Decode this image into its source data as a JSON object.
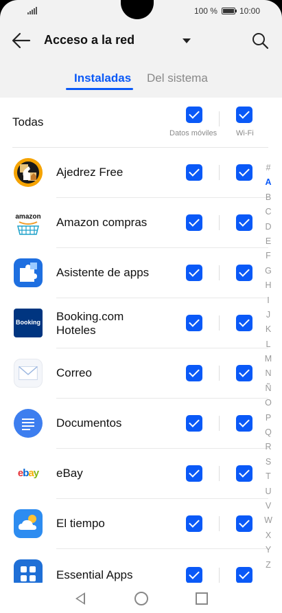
{
  "status": {
    "battery": "100 %",
    "time": "10:00"
  },
  "header": {
    "title": "Acceso a la red"
  },
  "tabs": [
    {
      "label": "Instaladas",
      "active": true
    },
    {
      "label": "Del sistema",
      "active": false
    }
  ],
  "all_row": {
    "label": "Todas",
    "mobile_data_label": "Datos móviles",
    "wifi_label": "Wi-Fi",
    "mobile_checked": true,
    "wifi_checked": true
  },
  "apps": [
    {
      "name": "Ajedrez Free",
      "icon": "chess-app-icon",
      "mobile": true,
      "wifi": true
    },
    {
      "name": "Amazon compras",
      "icon": "amazon-app-icon",
      "icon_text": "amazon",
      "mobile": true,
      "wifi": true
    },
    {
      "name": "Asistente de apps",
      "icon": "puzzle-app-icon",
      "mobile": true,
      "wifi": true
    },
    {
      "name": "Booking.com Hoteles",
      "name_line1": "Booking.com",
      "name_line2": "Hoteles",
      "icon": "booking-app-icon",
      "icon_text": "Booking",
      "mobile": true,
      "wifi": true
    },
    {
      "name": "Correo",
      "icon": "mail-app-icon",
      "mobile": true,
      "wifi": true
    },
    {
      "name": "Documentos",
      "icon": "documents-app-icon",
      "mobile": true,
      "wifi": true
    },
    {
      "name": "eBay",
      "icon": "ebay-app-icon",
      "icon_text": "ebay",
      "mobile": true,
      "wifi": true
    },
    {
      "name": "El tiempo",
      "icon": "weather-app-icon",
      "mobile": true,
      "wifi": true
    },
    {
      "name": "Essential Apps",
      "icon": "essential-apps-icon",
      "mobile": true,
      "wifi": true
    }
  ],
  "index": [
    "#",
    "A",
    "B",
    "C",
    "D",
    "E",
    "F",
    "G",
    "H",
    "I",
    "J",
    "K",
    "L",
    "M",
    "N",
    "Ñ",
    "O",
    "P",
    "Q",
    "R",
    "S",
    "T",
    "U",
    "V",
    "W",
    "X",
    "Y",
    "Z"
  ],
  "index_selected": "A",
  "colors": {
    "accent": "#0a59f7"
  }
}
